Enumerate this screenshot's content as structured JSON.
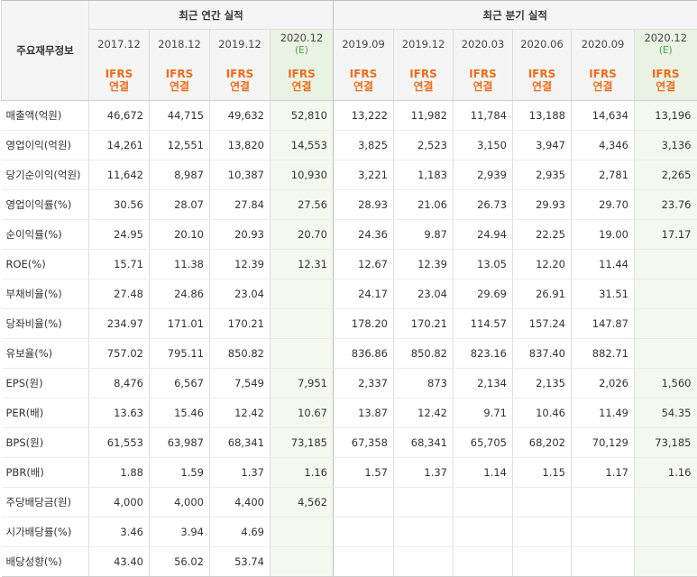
{
  "header": {
    "corner_label": "주요재무정보",
    "annual_group": "최근 연간 실적",
    "quarter_group": "최근 분기 실적",
    "ifrs_line1": "IFRS",
    "ifrs_line2": "연결",
    "annual_periods": [
      {
        "label": "2017.12",
        "est": ""
      },
      {
        "label": "2018.12",
        "est": ""
      },
      {
        "label": "2019.12",
        "est": ""
      },
      {
        "label": "2020.12",
        "est": "(E)"
      }
    ],
    "quarter_periods": [
      {
        "label": "2019.09",
        "est": ""
      },
      {
        "label": "2019.12",
        "est": ""
      },
      {
        "label": "2020.03",
        "est": ""
      },
      {
        "label": "2020.06",
        "est": ""
      },
      {
        "label": "2020.09",
        "est": ""
      },
      {
        "label": "2020.12",
        "est": "(E)"
      }
    ]
  },
  "rows": [
    {
      "label": "매출액(억원)",
      "annual": [
        "46,672",
        "44,715",
        "49,632",
        "52,810"
      ],
      "quarter": [
        "13,222",
        "11,982",
        "11,784",
        "13,188",
        "14,634",
        "13,196"
      ]
    },
    {
      "label": "영업이익(억원)",
      "annual": [
        "14,261",
        "12,551",
        "13,820",
        "14,553"
      ],
      "quarter": [
        "3,825",
        "2,523",
        "3,150",
        "3,947",
        "4,346",
        "3,136"
      ]
    },
    {
      "label": "당기순이익(억원)",
      "annual": [
        "11,642",
        "8,987",
        "10,387",
        "10,930"
      ],
      "quarter": [
        "3,221",
        "1,183",
        "2,939",
        "2,935",
        "2,781",
        "2,265"
      ]
    },
    {
      "label": "영업이익률(%)",
      "annual": [
        "30.56",
        "28.07",
        "27.84",
        "27.56"
      ],
      "quarter": [
        "28.93",
        "21.06",
        "26.73",
        "29.93",
        "29.70",
        "23.76"
      ]
    },
    {
      "label": "순이익률(%)",
      "annual": [
        "24.95",
        "20.10",
        "20.93",
        "20.70"
      ],
      "quarter": [
        "24.36",
        "9.87",
        "24.94",
        "22.25",
        "19.00",
        "17.17"
      ]
    },
    {
      "label": "ROE(%)",
      "annual": [
        "15.71",
        "11.38",
        "12.39",
        "12.31"
      ],
      "quarter": [
        "12.67",
        "12.39",
        "13.05",
        "12.20",
        "11.44",
        ""
      ]
    },
    {
      "label": "부채비율(%)",
      "annual": [
        "27.48",
        "24.86",
        "23.04",
        ""
      ],
      "quarter": [
        "24.17",
        "23.04",
        "29.69",
        "26.91",
        "31.51",
        ""
      ]
    },
    {
      "label": "당좌비율(%)",
      "annual": [
        "234.97",
        "171.01",
        "170.21",
        ""
      ],
      "quarter": [
        "178.20",
        "170.21",
        "114.57",
        "157.24",
        "147.87",
        ""
      ]
    },
    {
      "label": "유보율(%)",
      "annual": [
        "757.02",
        "795.11",
        "850.82",
        ""
      ],
      "quarter": [
        "836.86",
        "850.82",
        "823.16",
        "837.40",
        "882.71",
        ""
      ]
    },
    {
      "label": "EPS(원)",
      "annual": [
        "8,476",
        "6,567",
        "7,549",
        "7,951"
      ],
      "quarter": [
        "2,337",
        "873",
        "2,134",
        "2,135",
        "2,026",
        "1,560"
      ]
    },
    {
      "label": "PER(배)",
      "annual": [
        "13.63",
        "15.46",
        "12.42",
        "10.67"
      ],
      "quarter": [
        "13.87",
        "12.42",
        "9.71",
        "10.46",
        "11.49",
        "54.35"
      ]
    },
    {
      "label": "BPS(원)",
      "annual": [
        "61,553",
        "63,987",
        "68,341",
        "73,185"
      ],
      "quarter": [
        "67,358",
        "68,341",
        "65,705",
        "68,202",
        "70,129",
        "73,185"
      ]
    },
    {
      "label": "PBR(배)",
      "annual": [
        "1.88",
        "1.59",
        "1.37",
        "1.16"
      ],
      "quarter": [
        "1.57",
        "1.37",
        "1.14",
        "1.15",
        "1.17",
        "1.16"
      ]
    },
    {
      "label": "주당배당금(원)",
      "annual": [
        "4,000",
        "4,000",
        "4,400",
        "4,562"
      ],
      "quarter": [
        "",
        "",
        "",
        "",
        "",
        ""
      ]
    },
    {
      "label": "시가배당률(%)",
      "annual": [
        "3.46",
        "3.94",
        "4.69",
        ""
      ],
      "quarter": [
        "",
        "",
        "",
        "",
        "",
        ""
      ]
    },
    {
      "label": "배당성향(%)",
      "annual": [
        "43.40",
        "56.02",
        "53.74",
        ""
      ],
      "quarter": [
        "",
        "",
        "",
        "",
        "",
        ""
      ]
    }
  ],
  "colors": {
    "ifrs_orange": "#ef6c1b",
    "estimate_green": "#45a045",
    "estimate_bg": "#f3f9ef",
    "header_bg": "#f5f5f5"
  }
}
